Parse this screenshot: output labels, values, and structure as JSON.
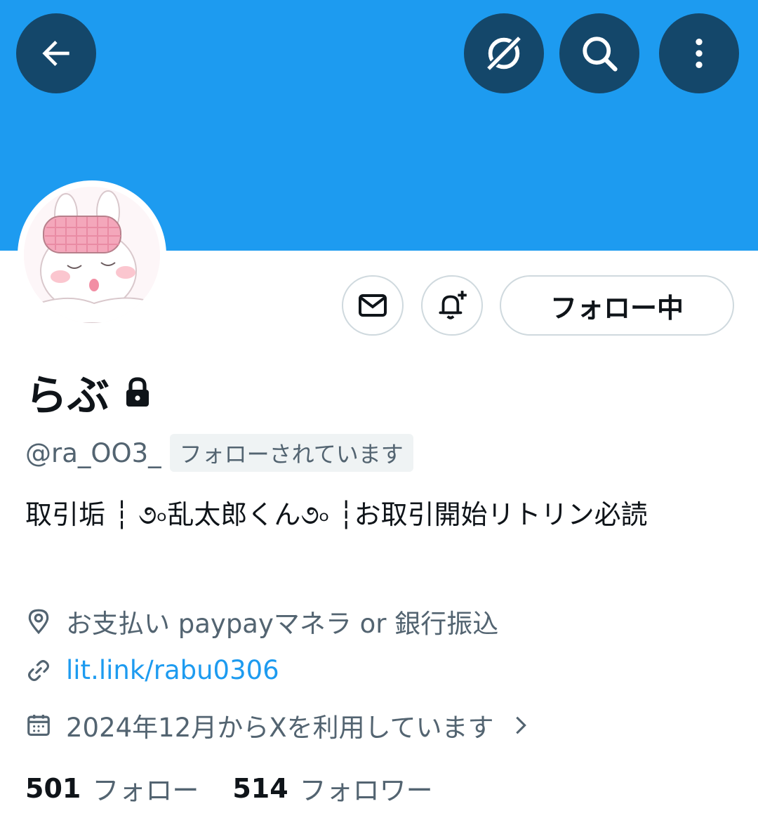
{
  "header": {
    "back_icon": "arrow-left-icon",
    "grok_icon": "grok-icon",
    "search_icon": "search-icon",
    "more_icon": "more-vertical-icon"
  },
  "profile": {
    "display_name": "らぶ",
    "handle": "@ra_OO3_",
    "follows_you_badge": "フォローされています",
    "bio": "取引垢 ┆ ૭৹乱太郎くん૭৹ ┆お取引開始リトリン必読",
    "location": "お支払い paypayマネラ or 銀行振込",
    "website": "lit.link/rabu0306",
    "joined": "2024年12月からXを利用しています"
  },
  "actions": {
    "message_icon": "mail-icon",
    "notify_icon": "bell-plus-icon",
    "follow_label": "フォロー中"
  },
  "stats": {
    "following_count": "501",
    "following_label": "フォロー",
    "followers_count": "514",
    "followers_label": "フォロワー"
  },
  "colors": {
    "banner": "#1d9bf0",
    "accent": "#1d9bf0",
    "secondary_text": "#536471"
  }
}
